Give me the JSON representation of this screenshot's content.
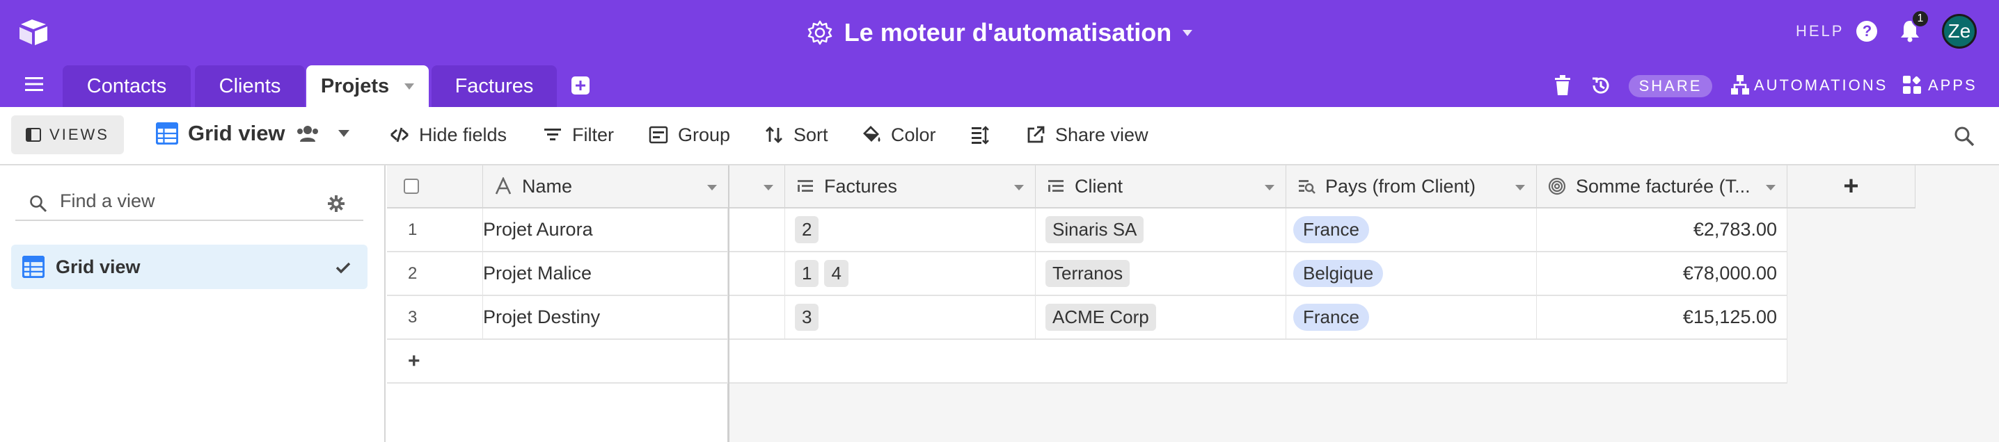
{
  "base": {
    "title": "Le moteur d'automatisation"
  },
  "topbar": {
    "help_label": "HELP",
    "help_symbol": "?",
    "notification_count": "1",
    "avatar_initials": "Ze",
    "accent": "#7a3fe3"
  },
  "tables": [
    {
      "label": "Contacts"
    },
    {
      "label": "Clients"
    },
    {
      "label": "Projets",
      "active": true
    },
    {
      "label": "Factures"
    }
  ],
  "right_actions": {
    "share_label": "SHARE",
    "automations_label": "AUTOMATIONS",
    "apps_label": "APPS"
  },
  "toolbar": {
    "views_label": "VIEWS",
    "view_name": "Grid view",
    "hide_fields": "Hide fields",
    "filter": "Filter",
    "group": "Group",
    "sort": "Sort",
    "color": "Color",
    "share_view": "Share view"
  },
  "sidebar": {
    "find_placeholder": "Find a view",
    "views": [
      {
        "label": "Grid view",
        "selected": true
      }
    ]
  },
  "grid": {
    "columns": [
      "Name",
      "Factures",
      "Client",
      "Pays (from Client)",
      "Somme facturée (T..."
    ],
    "rows": [
      {
        "num": "1",
        "name": "Projet Aurora",
        "factures": [
          "2"
        ],
        "client": "Sinaris SA",
        "pays": "France",
        "somme": "€2,783.00"
      },
      {
        "num": "2",
        "name": "Projet Malice",
        "factures": [
          "1",
          "4"
        ],
        "client": "Terranos",
        "pays": "Belgique",
        "somme": "€78,000.00"
      },
      {
        "num": "3",
        "name": "Projet Destiny",
        "factures": [
          "3"
        ],
        "client": "ACME Corp",
        "pays": "France",
        "somme": "€15,125.00"
      }
    ],
    "add_row_symbol": "+",
    "add_column_symbol": "+"
  }
}
